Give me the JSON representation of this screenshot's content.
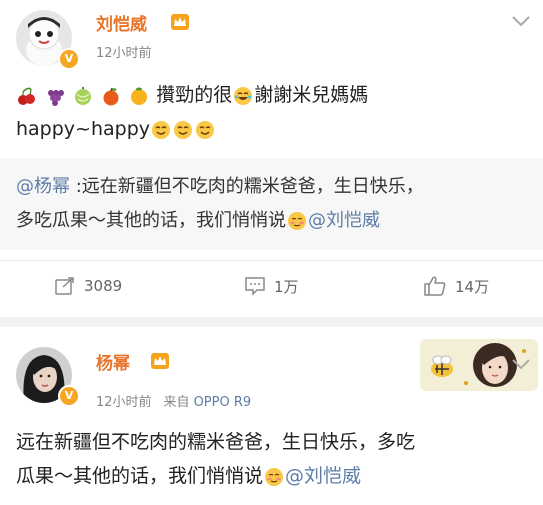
{
  "post1": {
    "author": "刘恺威",
    "time": "12小时前",
    "line1_text": "攢勁的很",
    "line1_text2": "謝謝米兒媽媽",
    "line2_text": "happy~happy",
    "quote": {
      "mention": "@杨幂",
      "text1": " :远在新疆但不吃肉的糯米爸爸，生日快乐，",
      "text2": "多吃瓜果～其他的话，我们悄悄说",
      "mention2": "@刘恺威"
    },
    "actions": {
      "repost": "3089",
      "comment": "1万",
      "like": "14万"
    }
  },
  "post2": {
    "author": "杨幂",
    "time": "12小时前",
    "source_prefix": "来自",
    "device": "OPPO R9",
    "line1": "远在新疆但不吃肉的糯米爸爸，生日快乐，多吃",
    "line2": "瓜果～其他的话，我们悄悄说",
    "mention": "@刘恺威"
  },
  "colors": {
    "name": "#e8742a",
    "link": "#5d7da8",
    "badge": "#f5a623"
  }
}
